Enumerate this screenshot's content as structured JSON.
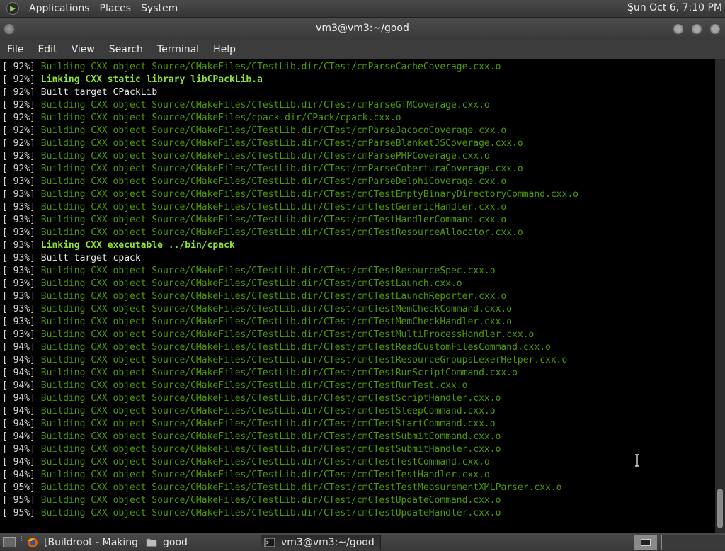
{
  "top_panel": {
    "menus": [
      "Applications",
      "Places",
      "System"
    ],
    "clock": "Sun Oct  6,  7:10 PM"
  },
  "window": {
    "title": "vm3@vm3:~/good"
  },
  "menubar": {
    "items": [
      "File",
      "Edit",
      "View",
      "Search",
      "Terminal",
      "Help"
    ]
  },
  "colors": {
    "build_text": "#4e9a06",
    "link_text": "#8ae234",
    "plain_text": "#e6e6e6",
    "terminal_bg": "#000000"
  },
  "terminal": {
    "lines": [
      {
        "pct": "[ 92%]",
        "kind": "build",
        "text": "Building CXX object Source/CMakeFiles/CTestLib.dir/CTest/cmParseCacheCoverage.cxx.o"
      },
      {
        "pct": "[ 92%]",
        "kind": "link",
        "text": "Linking CXX static library libCPackLib.a"
      },
      {
        "pct": "[ 92%]",
        "kind": "built",
        "text": "Built target CPackLib"
      },
      {
        "pct": "[ 92%]",
        "kind": "build",
        "text": "Building CXX object Source/CMakeFiles/CTestLib.dir/CTest/cmParseGTMCoverage.cxx.o"
      },
      {
        "pct": "[ 92%]",
        "kind": "build",
        "text": "Building CXX object Source/CMakeFiles/cpack.dir/CPack/cpack.cxx.o"
      },
      {
        "pct": "[ 92%]",
        "kind": "build",
        "text": "Building CXX object Source/CMakeFiles/CTestLib.dir/CTest/cmParseJacocoCoverage.cxx.o"
      },
      {
        "pct": "[ 92%]",
        "kind": "build",
        "text": "Building CXX object Source/CMakeFiles/CTestLib.dir/CTest/cmParseBlanketJSCoverage.cxx.o"
      },
      {
        "pct": "[ 92%]",
        "kind": "build",
        "text": "Building CXX object Source/CMakeFiles/CTestLib.dir/CTest/cmParsePHPCoverage.cxx.o"
      },
      {
        "pct": "[ 92%]",
        "kind": "build",
        "text": "Building CXX object Source/CMakeFiles/CTestLib.dir/CTest/cmParseCoberturaCoverage.cxx.o"
      },
      {
        "pct": "[ 93%]",
        "kind": "build",
        "text": "Building CXX object Source/CMakeFiles/CTestLib.dir/CTest/cmParseDelphiCoverage.cxx.o"
      },
      {
        "pct": "[ 93%]",
        "kind": "build",
        "text": "Building CXX object Source/CMakeFiles/CTestLib.dir/CTest/cmCTestEmptyBinaryDirectoryCommand.cxx.o"
      },
      {
        "pct": "[ 93%]",
        "kind": "build",
        "text": "Building CXX object Source/CMakeFiles/CTestLib.dir/CTest/cmCTestGenericHandler.cxx.o"
      },
      {
        "pct": "[ 93%]",
        "kind": "build",
        "text": "Building CXX object Source/CMakeFiles/CTestLib.dir/CTest/cmCTestHandlerCommand.cxx.o"
      },
      {
        "pct": "[ 93%]",
        "kind": "build",
        "text": "Building CXX object Source/CMakeFiles/CTestLib.dir/CTest/cmCTestResourceAllocator.cxx.o"
      },
      {
        "pct": "[ 93%]",
        "kind": "link",
        "text": "Linking CXX executable ../bin/cpack"
      },
      {
        "pct": "[ 93%]",
        "kind": "built",
        "text": "Built target cpack"
      },
      {
        "pct": "[ 93%]",
        "kind": "build",
        "text": "Building CXX object Source/CMakeFiles/CTestLib.dir/CTest/cmCTestResourceSpec.cxx.o"
      },
      {
        "pct": "[ 93%]",
        "kind": "build",
        "text": "Building CXX object Source/CMakeFiles/CTestLib.dir/CTest/cmCTestLaunch.cxx.o"
      },
      {
        "pct": "[ 93%]",
        "kind": "build",
        "text": "Building CXX object Source/CMakeFiles/CTestLib.dir/CTest/cmCTestLaunchReporter.cxx.o"
      },
      {
        "pct": "[ 93%]",
        "kind": "build",
        "text": "Building CXX object Source/CMakeFiles/CTestLib.dir/CTest/cmCTestMemCheckCommand.cxx.o"
      },
      {
        "pct": "[ 93%]",
        "kind": "build",
        "text": "Building CXX object Source/CMakeFiles/CTestLib.dir/CTest/cmCTestMemCheckHandler.cxx.o"
      },
      {
        "pct": "[ 93%]",
        "kind": "build",
        "text": "Building CXX object Source/CMakeFiles/CTestLib.dir/CTest/cmCTestMultiProcessHandler.cxx.o"
      },
      {
        "pct": "[ 94%]",
        "kind": "build",
        "text": "Building CXX object Source/CMakeFiles/CTestLib.dir/CTest/cmCTestReadCustomFilesCommand.cxx.o"
      },
      {
        "pct": "[ 94%]",
        "kind": "build",
        "text": "Building CXX object Source/CMakeFiles/CTestLib.dir/CTest/cmCTestResourceGroupsLexerHelper.cxx.o"
      },
      {
        "pct": "[ 94%]",
        "kind": "build",
        "text": "Building CXX object Source/CMakeFiles/CTestLib.dir/CTest/cmCTestRunScriptCommand.cxx.o"
      },
      {
        "pct": "[ 94%]",
        "kind": "build",
        "text": "Building CXX object Source/CMakeFiles/CTestLib.dir/CTest/cmCTestRunTest.cxx.o"
      },
      {
        "pct": "[ 94%]",
        "kind": "build",
        "text": "Building CXX object Source/CMakeFiles/CTestLib.dir/CTest/cmCTestScriptHandler.cxx.o"
      },
      {
        "pct": "[ 94%]",
        "kind": "build",
        "text": "Building CXX object Source/CMakeFiles/CTestLib.dir/CTest/cmCTestSleepCommand.cxx.o"
      },
      {
        "pct": "[ 94%]",
        "kind": "build",
        "text": "Building CXX object Source/CMakeFiles/CTestLib.dir/CTest/cmCTestStartCommand.cxx.o"
      },
      {
        "pct": "[ 94%]",
        "kind": "build",
        "text": "Building CXX object Source/CMakeFiles/CTestLib.dir/CTest/cmCTestSubmitCommand.cxx.o"
      },
      {
        "pct": "[ 94%]",
        "kind": "build",
        "text": "Building CXX object Source/CMakeFiles/CTestLib.dir/CTest/cmCTestSubmitHandler.cxx.o"
      },
      {
        "pct": "[ 94%]",
        "kind": "build",
        "text": "Building CXX object Source/CMakeFiles/CTestLib.dir/CTest/cmCTestTestCommand.cxx.o"
      },
      {
        "pct": "[ 94%]",
        "kind": "build",
        "text": "Building CXX object Source/CMakeFiles/CTestLib.dir/CTest/cmCTestTestHandler.cxx.o"
      },
      {
        "pct": "[ 95%]",
        "kind": "build",
        "text": "Building CXX object Source/CMakeFiles/CTestLib.dir/CTest/cmCTestTestMeasurementXMLParser.cxx.o"
      },
      {
        "pct": "[ 95%]",
        "kind": "build",
        "text": "Building CXX object Source/CMakeFiles/CTestLib.dir/CTest/cmCTestUpdateCommand.cxx.o"
      },
      {
        "pct": "[ 95%]",
        "kind": "build",
        "text": "Building CXX object Source/CMakeFiles/CTestLib.dir/CTest/cmCTestUpdateHandler.cxx.o"
      }
    ]
  },
  "taskbar": {
    "tasks": [
      {
        "label": "[Buildroot - Making ...",
        "icon": "firefox-icon",
        "active": false
      },
      {
        "label": "good",
        "icon": "folder-icon",
        "active": false
      },
      {
        "label": "vm3@vm3:~/good",
        "icon": "terminal-icon",
        "active": true
      }
    ]
  }
}
